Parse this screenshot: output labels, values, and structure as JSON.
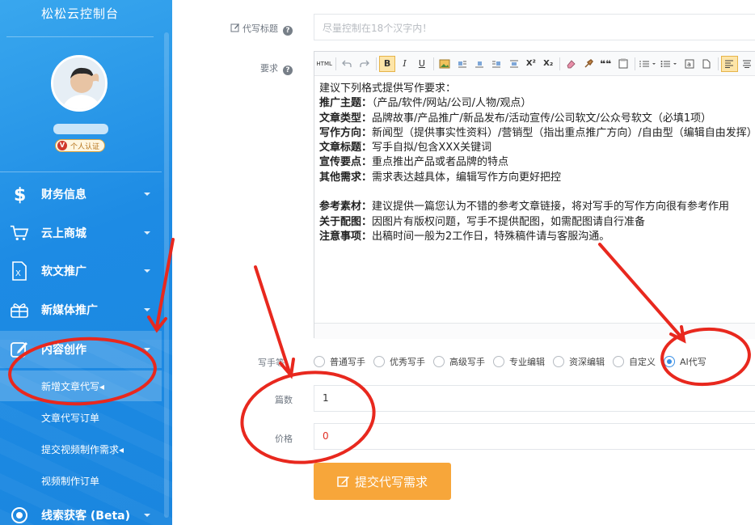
{
  "sidebar": {
    "brand": "松松云控制台",
    "verify_badge": "个人认证",
    "verify_mark": "V",
    "nav": [
      {
        "label": "财务信息",
        "icon": "dollar-icon"
      },
      {
        "label": "云上商城",
        "icon": "shopping-cart-icon"
      },
      {
        "label": "软文推广",
        "icon": "document-icon"
      },
      {
        "label": "新媒体推广",
        "icon": "gift-icon"
      },
      {
        "label": "内容创作",
        "icon": "edit-icon"
      },
      {
        "label": "线索获客 (Beta)",
        "icon": "target-icon"
      }
    ],
    "sub_items": [
      "新增文章代写◂",
      "文章代写订单",
      "提交视频制作需求◂",
      "视频制作订单"
    ]
  },
  "form": {
    "title_label": "代写标题",
    "title_placeholder": "尽量控制在18个汉字内！",
    "req_label": "要求",
    "help_glyph": "?",
    "editor_lines": [
      {
        "key": "",
        "text": "建议下列格式提供写作要求："
      },
      {
        "key": "推广主题：",
        "text": "（产品/软件/网站/公司/人物/观点）"
      },
      {
        "key": "文章类型：",
        "text": "品牌故事/产品推广/新品发布/活动宣传/公司软文/公众号软文（必填1项）"
      },
      {
        "key": "写作方向：",
        "text": "新闻型（提供事实性资料）/营销型（指出重点推广方向）/自由型（编辑自由发挥）"
      },
      {
        "key": "文章标题：",
        "text": "写手自拟/包含XXX关键词"
      },
      {
        "key": "宣传要点：",
        "text": "重点推出产品或者品牌的特点"
      },
      {
        "key": "其他需求：",
        "text": "需求表达越具体，编辑写作方向更好把控"
      },
      {
        "key": "",
        "text": ""
      },
      {
        "key": "参考素材：",
        "text": "建议提供一篇您认为不错的参考文章链接，将对写手的写作方向很有参考作用"
      },
      {
        "key": "关于配图：",
        "text": "因图片有版权问题，写手不提供配图，如需配图请自行准备"
      },
      {
        "key": "注意事项：",
        "text": "出稿时间一般为2工作日，特殊稿件请与客服沟通。"
      }
    ],
    "writer_label": "写手等",
    "writer_options": [
      "普通写手",
      "优秀写手",
      "高级写手",
      "专业编辑",
      "资深编辑",
      "自定义",
      "AI代写"
    ],
    "writer_selected": "AI代写",
    "count_label": "篇数",
    "count_value": "1",
    "price_label": "价格",
    "price_value": "0",
    "submit_label": "提交代写需求"
  },
  "toolbar": {
    "html": "HTML",
    "bold": "B",
    "italic": "I",
    "underline": "U",
    "superscript": "X²",
    "subscript": "X₂",
    "quote": "❝❝"
  },
  "colors": {
    "sidebar": "#1d8be4",
    "accent_button": "#f7a63a",
    "price_text": "#e02f24",
    "annotation": "#e8281e",
    "radio_selected": "#3a90e6"
  }
}
